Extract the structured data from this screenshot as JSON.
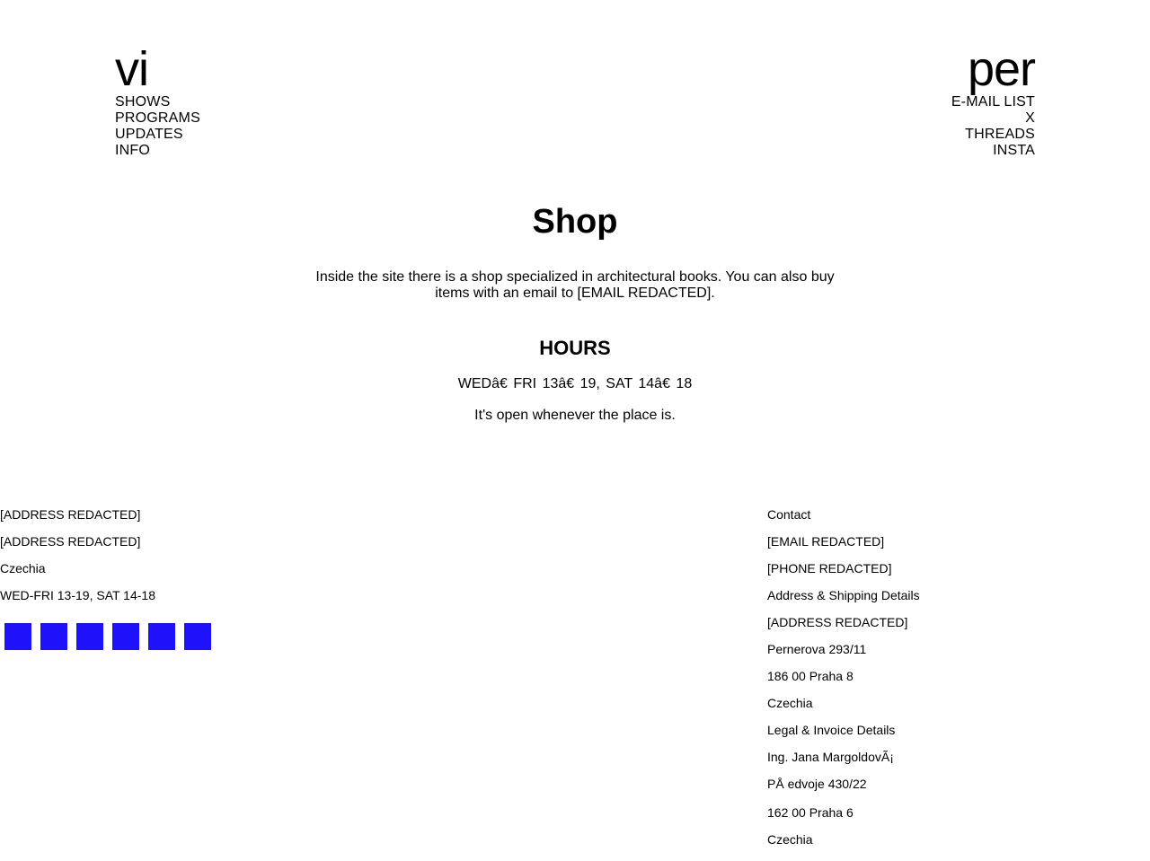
{
  "header": {
    "logo_left": "vi",
    "logo_right": "per",
    "nav_left": [
      "SHOWS",
      "PROGRAMS",
      "UPDATES",
      "INFO"
    ],
    "nav_right": [
      "E-MAIL LIST",
      "X",
      "THREADS",
      "INSTA"
    ]
  },
  "main": {
    "title": "Shop",
    "intro": "Inside the site there is a shop specialized in architectural books. You can also buy items with an email to [EMAIL REDACTED].",
    "hours_title": "HOURS",
    "hours_line": "WEDâ€ FRI 13â€ 19, SAT 14â€ 18",
    "hours_note": "It's open whenever the place is."
  },
  "footer": {
    "left_lines": [
      "[ADDRESS REDACTED]",
      "[ADDRESS REDACTED]",
      "Czechia",
      "WED-FRI 13-19, SAT 14-18"
    ],
    "social_icons": [
      "social-icon-1",
      "social-icon-2",
      "social-icon-3",
      "social-icon-4",
      "social-icon-5",
      "social-icon-6"
    ],
    "social_color": "#1e12fa",
    "right_lines": [
      "Contact",
      "[EMAIL REDACTED]",
      "[PHONE REDACTED]",
      "Address & Shipping Details",
      "[ADDRESS REDACTED]",
      "Pernerova 293/11",
      "186 00 Praha 8",
      "Czechia",
      "Legal & Invoice Details",
      "Ing. Jana MargoldovÃ¡",
      "PÅ edvoje 430/22",
      "162 00 Praha 6",
      "Czechia"
    ]
  }
}
